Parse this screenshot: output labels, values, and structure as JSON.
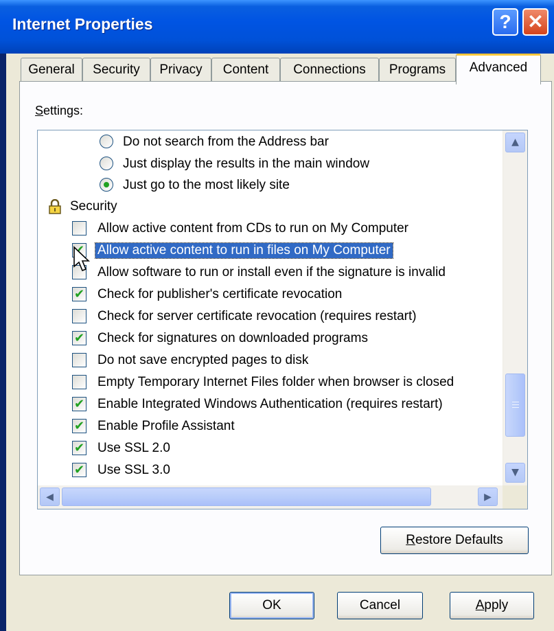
{
  "window": {
    "title": "Internet Properties",
    "help_glyph": "?",
    "close_glyph": "✕"
  },
  "tabs": [
    {
      "label": "General"
    },
    {
      "label": "Security"
    },
    {
      "label": "Privacy"
    },
    {
      "label": "Content"
    },
    {
      "label": "Connections"
    },
    {
      "label": "Programs"
    },
    {
      "label": "Advanced",
      "active": true
    }
  ],
  "settings": {
    "label": "Settings:",
    "items": [
      {
        "type": "radio",
        "label": "Do not search from the Address bar",
        "checked": false
      },
      {
        "type": "radio",
        "label": "Just display the results in the main window",
        "checked": false
      },
      {
        "type": "radio",
        "label": "Just go to the most likely site",
        "checked": true
      },
      {
        "type": "category",
        "label": "Security",
        "icon": "lock-icon"
      },
      {
        "type": "checkbox",
        "label": "Allow active content from CDs to run on My Computer",
        "checked": false
      },
      {
        "type": "checkbox",
        "label": "Allow active content to run in files on My Computer",
        "checked": true,
        "selected": true
      },
      {
        "type": "checkbox",
        "label": "Allow software to run or install even if the signature is invalid",
        "checked": false
      },
      {
        "type": "checkbox",
        "label": "Check for publisher's certificate revocation",
        "checked": true
      },
      {
        "type": "checkbox",
        "label": "Check for server certificate revocation (requires restart)",
        "checked": false
      },
      {
        "type": "checkbox",
        "label": "Check for signatures on downloaded programs",
        "checked": true
      },
      {
        "type": "checkbox",
        "label": "Do not save encrypted pages to disk",
        "checked": false
      },
      {
        "type": "checkbox",
        "label": "Empty Temporary Internet Files folder when browser is closed",
        "checked": false
      },
      {
        "type": "checkbox",
        "label": "Enable Integrated Windows Authentication (requires restart)",
        "checked": true
      },
      {
        "type": "checkbox",
        "label": "Enable Profile Assistant",
        "checked": true
      },
      {
        "type": "checkbox",
        "label": "Use SSL 2.0",
        "checked": true
      },
      {
        "type": "checkbox",
        "label": "Use SSL 3.0",
        "checked": true
      }
    ]
  },
  "glyphs": {
    "check": "✔",
    "up": "▲",
    "down": "▼",
    "left": "◀",
    "right": "▶"
  },
  "buttons": {
    "restore_defaults": "Restore Defaults",
    "ok": "OK",
    "cancel": "Cancel",
    "apply": "Apply"
  }
}
